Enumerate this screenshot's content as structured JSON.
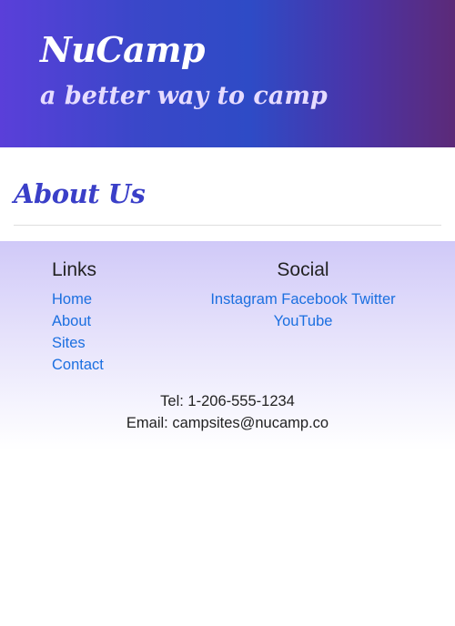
{
  "header": {
    "brand": "NuCamp",
    "tagline": "a better way to camp"
  },
  "main": {
    "title": "About Us"
  },
  "footer": {
    "links_heading": "Links",
    "links": [
      "Home",
      "About",
      "Sites",
      "Contact"
    ],
    "social_heading": "Social",
    "social": [
      "Instagram",
      "Facebook",
      "Twitter",
      "YouTube"
    ],
    "contact": {
      "tel": "Tel: 1-206-555-1234",
      "email_label": "Email: ",
      "email": "campsites@nucamp.co"
    }
  },
  "colors": {
    "header_gradient_start": "#5a3fd9",
    "header_gradient_end": "#5c2a78",
    "title": "#3a3fc8",
    "link": "#1b6fe0",
    "footer_bg": "#d0c9f8"
  }
}
